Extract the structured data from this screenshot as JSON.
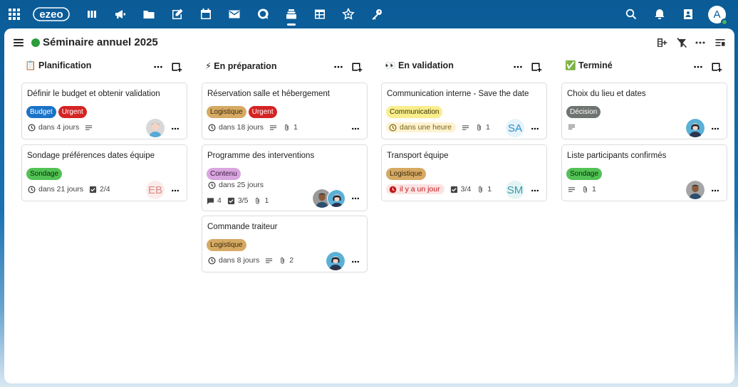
{
  "app": {
    "logo_text": "ezeo",
    "user_initial": "A",
    "accent": "#0a5b96"
  },
  "topbar_icons": [
    "apps-grid-icon",
    "dashboard-icon",
    "megaphone-icon",
    "folder-icon",
    "notes-icon",
    "calendar-icon",
    "mail-icon",
    "talk-icon",
    "deck-icon",
    "tables-icon",
    "star-network-icon",
    "key-icon",
    "search-icon",
    "bell-icon",
    "contacts-icon"
  ],
  "board": {
    "title": "Séminaire annuel 2025",
    "color": "#2b9d3b"
  },
  "columns": [
    {
      "title": "📋 Planification",
      "cards": [
        {
          "title": "Définir le budget et obtenir validation",
          "tags": [
            {
              "label": "Budget",
              "bg": "#1a73c8",
              "fg": "#ffffff"
            },
            {
              "label": "Urgent",
              "bg": "#d42424",
              "fg": "#ffffff"
            }
          ],
          "due": "dans 4 jours",
          "description": true,
          "avatar": "person-grey"
        },
        {
          "title": "Sondage préférences dates équipe",
          "tags": [
            {
              "label": "Sondage",
              "bg": "#52c254",
              "fg": "#0b2a0b"
            }
          ],
          "due": "dans 21 jours",
          "checklist": "2/4",
          "avatar_text": "EB",
          "avatar_color": "#d98a80",
          "avatar_bg": "#fbeceb"
        }
      ]
    },
    {
      "title": "⚡ En préparation",
      "cards": [
        {
          "title": "Réservation salle et hébergement",
          "tags": [
            {
              "label": "Logistique",
              "bg": "#d6aa63",
              "fg": "#3a2a0d"
            },
            {
              "label": "Urgent",
              "bg": "#d42424",
              "fg": "#ffffff"
            }
          ],
          "due": "dans 18 jours",
          "description": true,
          "attachments": "1"
        },
        {
          "title": "Programme des interventions",
          "tags": [
            {
              "label": "Contenu",
              "bg": "#d9a6e0",
              "fg": "#3a1a40"
            }
          ],
          "due": "dans 25 jours",
          "comments": "4",
          "checklist": "3/5",
          "attachments": "1"
        },
        {
          "title": "Commande traiteur",
          "tags": [
            {
              "label": "Logistique",
              "bg": "#d6aa63",
              "fg": "#3a2a0d"
            }
          ],
          "due": "dans 8 jours",
          "description": true,
          "attachments": "2"
        }
      ]
    },
    {
      "title": "👀 En validation",
      "cards": [
        {
          "title": "Communication interne - Save the date",
          "tags": [
            {
              "label": "Communication",
              "bg": "#f9ee8c",
              "fg": "#3a3408"
            }
          ],
          "due": "dans une heure",
          "description": true,
          "attachments": "1",
          "avatar_text": "SA",
          "avatar_color": "#2a8fc7",
          "avatar_bg": "#e6f3fb"
        },
        {
          "title": "Transport équipe",
          "tags": [
            {
              "label": "Logistique",
              "bg": "#d6aa63",
              "fg": "#3a2a0d"
            }
          ],
          "due": "il y a un jour",
          "checklist": "3/4",
          "attachments": "1",
          "avatar_text": "SM",
          "avatar_color": "#3a9aa8",
          "avatar_bg": "#e4f4f5"
        }
      ]
    },
    {
      "title": "✅ Terminé",
      "cards": [
        {
          "title": "Choix du lieu et dates",
          "tags": [
            {
              "label": "Décision",
              "bg": "#6f7470",
              "fg": "#ffffff"
            }
          ],
          "description": true
        },
        {
          "title": "Liste participants confirmés",
          "tags": [
            {
              "label": "Sondage",
              "bg": "#52c254",
              "fg": "#0b2a0b"
            }
          ],
          "description": true,
          "attachments": "1"
        }
      ]
    }
  ]
}
